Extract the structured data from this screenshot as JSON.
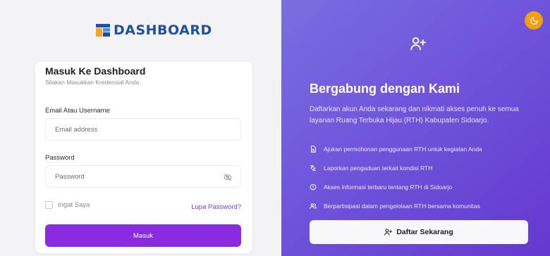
{
  "logo": {
    "text": "DASHBOARD"
  },
  "login": {
    "title": "Masuk Ke Dashboard",
    "subtitle": "Silakan Masukkan Kredensial Anda",
    "email_label": "Email Atau Username",
    "email_placeholder": "Email address",
    "password_label": "Password",
    "password_placeholder": "Password",
    "remember_label": "Ingat Saya",
    "forgot_label": "Lupa Password?",
    "submit_label": "Masuk"
  },
  "register": {
    "title": "Bergabung dengan Kami",
    "description": "Daftarkan akun Anda sekarang dan nikmati akses penuh ke semua layanan Ruang Terbuka Hijau (RTH) Kabupaten Sidoarjo.",
    "features": [
      {
        "icon": "document-icon",
        "text": "Ajukan permohonan penggunaan RTH untuk kegiatan Anda"
      },
      {
        "icon": "report-icon",
        "text": "Laporkan pengaduan terkait kondisi RTH"
      },
      {
        "icon": "info-icon",
        "text": "Akses informasi terbaru tentang RTH di Sidoarjo"
      },
      {
        "icon": "users-icon",
        "text": "Berpartisipasi dalam pengelolaan RTH bersama komunitas"
      }
    ],
    "cta_label": "Daftar Sekarang"
  },
  "colors": {
    "accent": "#8a2be2",
    "link": "#7c3aed",
    "theme_toggle": "#f59e0b",
    "logo": "#1f4fa3"
  }
}
